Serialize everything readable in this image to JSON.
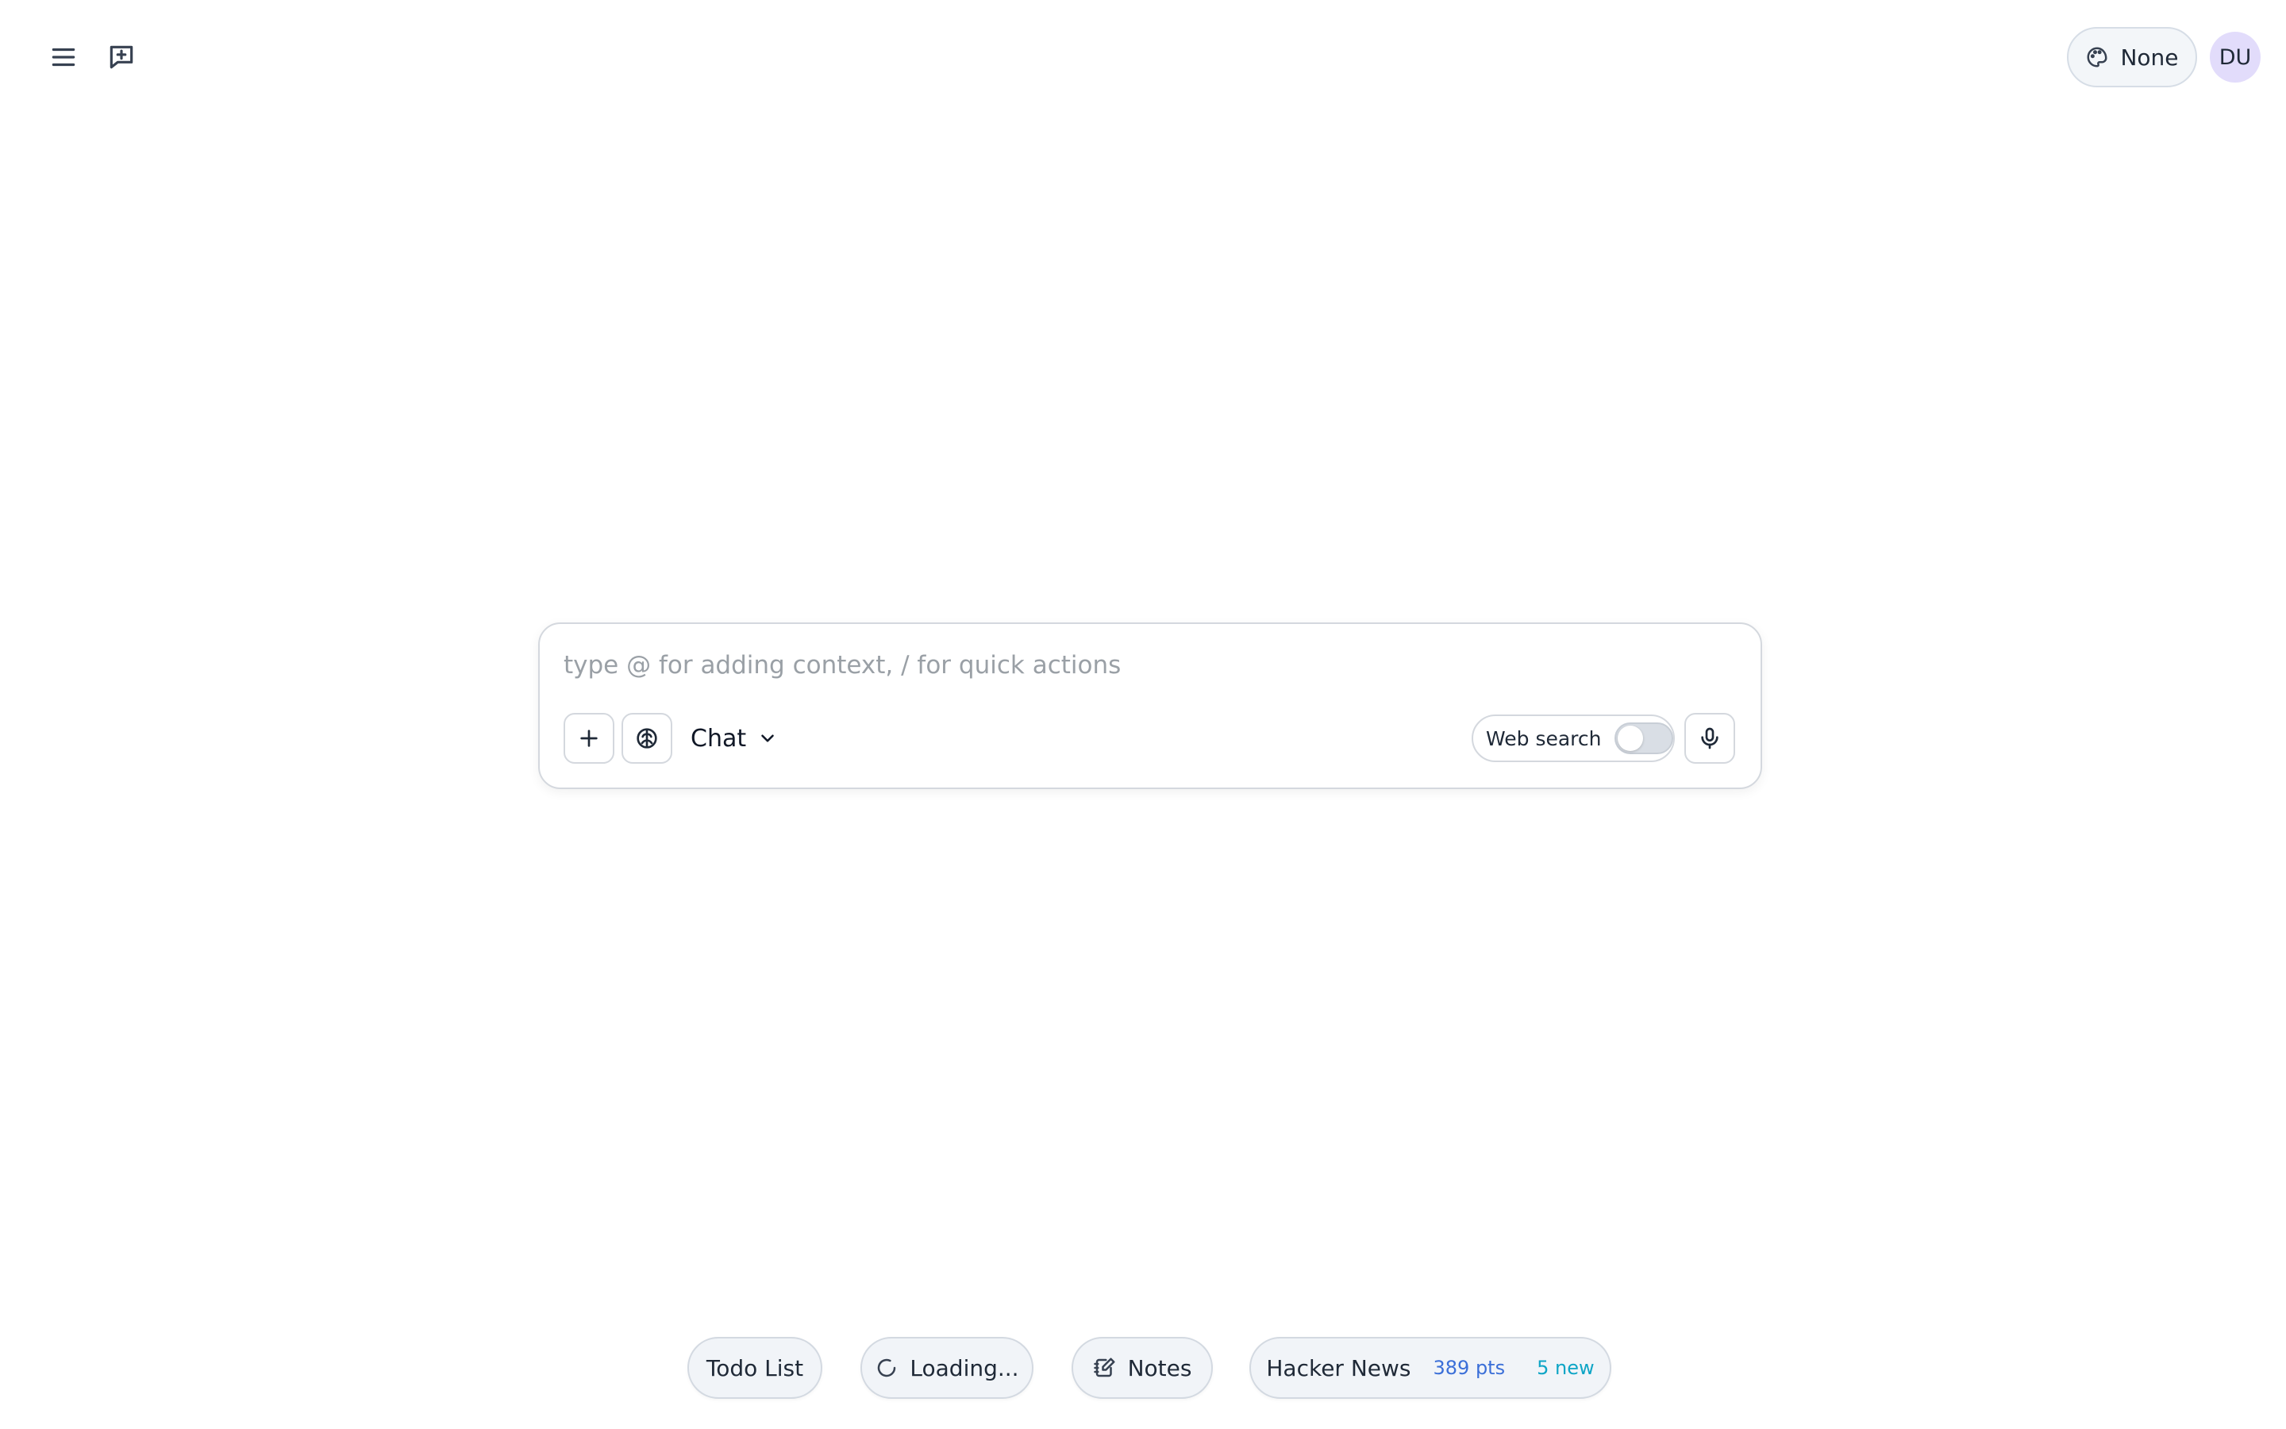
{
  "header": {
    "menu_icon": "hamburger-menu-icon",
    "new_chat_icon": "message-plus-icon",
    "theme": {
      "icon": "palette-icon",
      "label": "None"
    },
    "avatar": {
      "initials": "DU"
    }
  },
  "composer": {
    "placeholder": "type @ for adding context, / for quick actions",
    "value": "",
    "attach_icon": "plus-icon",
    "brain_icon": "brain-icon",
    "mode_label": "Chat",
    "mode_icon": "chevron-down-icon",
    "web_search_label": "Web search",
    "web_search_enabled": false,
    "mic_icon": "microphone-icon"
  },
  "widgets": {
    "todo": {
      "label": "Todo List"
    },
    "loading": {
      "label": "Loading...",
      "icon": "spinner-icon"
    },
    "notes": {
      "label": "Notes",
      "icon": "notebook-pen-icon"
    },
    "hacker_news": {
      "label": "Hacker News",
      "points": "389 pts",
      "new_count": "5 new"
    }
  },
  "colors": {
    "accent_blue": "#3b6fd8",
    "accent_cyan": "#0ea5c6",
    "avatar_bg": "#e2dcfb",
    "pill_bg": "#f1f4f8"
  }
}
